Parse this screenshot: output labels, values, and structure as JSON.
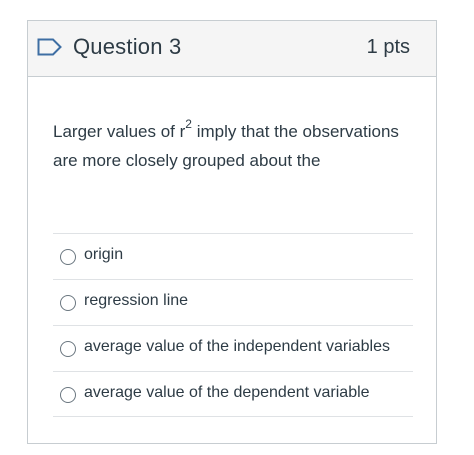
{
  "question": {
    "title": "Question 3",
    "points": "1 pts",
    "text_before_sup": "Larger values of r",
    "sup": "2",
    "text_after_sup": " imply that the observations are more closely grouped about the",
    "flag_icon": "flag-outline-icon"
  },
  "answers": [
    {
      "label": "origin"
    },
    {
      "label": "regression line"
    },
    {
      "label": "average value of the independent variables"
    },
    {
      "label": "average value of the dependent variable"
    }
  ],
  "colors": {
    "text": "#2d3b45",
    "header_bg": "#f5f5f5",
    "border": "#c7cdd1",
    "flag_stroke": "#3e6ea3"
  }
}
